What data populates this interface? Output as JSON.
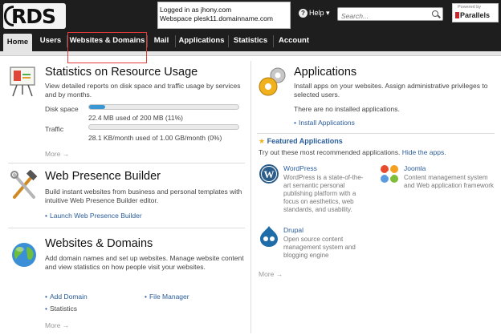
{
  "header": {
    "logo": "RDS",
    "login_line1": "Logged in as jhony.com",
    "login_line2": "Webspace plesk11.domainname.com",
    "help_label": "Help",
    "search_placeholder": "Search...",
    "powered_by": "Powered by",
    "brand": "Parallels"
  },
  "nav": {
    "tabs": [
      "Home",
      "Users",
      "Websites & Domains",
      "Mail",
      "Applications",
      "Statistics",
      "Account"
    ]
  },
  "stats": {
    "title": "Statistics on Resource Usage",
    "desc": "View detailed reports on disk space and traffic usage by services and by months.",
    "disk_label": "Disk space",
    "disk_text": "22.4 MB used of 200 MB (11%)",
    "disk_fraction": 0.11,
    "traffic_label": "Traffic",
    "traffic_text": "28.1 KB/month used of 1.00 GB/month (0%)",
    "traffic_fraction": 0.0,
    "more": "More →"
  },
  "wpb": {
    "title": "Web Presence Builder",
    "desc": "Build instant websites from business and personal templates with intuitive Web Presence Builder editor.",
    "launch": "Launch Web Presence Builder"
  },
  "wd": {
    "title": "Websites & Domains",
    "desc": "Add domain names and set up websites. Manage website content and view statistics on how people visit your websites.",
    "add_domain": "Add Domain",
    "file_manager": "File Manager",
    "statistics": "Statistics",
    "more": "More →"
  },
  "apps": {
    "title": "Applications",
    "desc": "Install apps on your websites. Assign administrative privileges to selected users.",
    "none": "There are no installed applications.",
    "install": "Install Applications",
    "featured_title": "Featured Applications",
    "featured_desc": "Try out these most recommended applications.",
    "hide": "Hide the apps.",
    "items": [
      {
        "name": "WordPress",
        "desc": "WordPress is a state-of-the-art semantic personal publishing platform with a focus on aesthetics, web standards, and usability."
      },
      {
        "name": "Joomla",
        "desc": "Content management system and Web application framework"
      },
      {
        "name": "Drupal",
        "desc": "Open source content management system and blogging engine"
      }
    ],
    "more": "More →"
  }
}
